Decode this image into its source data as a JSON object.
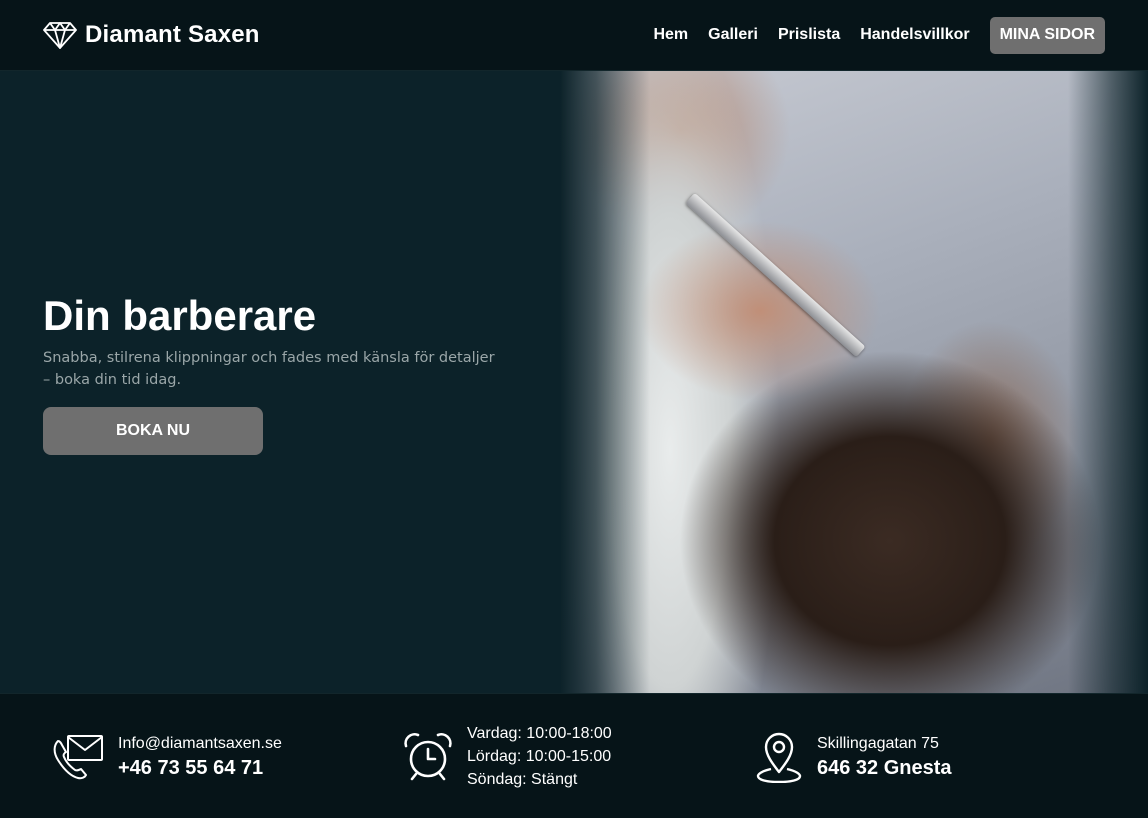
{
  "header": {
    "brand": "Diamant Saxen",
    "logo_icon": "diamond-icon",
    "nav": [
      "Hem",
      "Galleri",
      "Prislista",
      "Handelsvillkor"
    ],
    "account_button": "MINA SIDOR"
  },
  "hero": {
    "title": "Din barberare",
    "subtitle_line1": "Snabba, stilrena klippningar och fades med känsla för detaljer",
    "subtitle_line2": "– boka din tid idag.",
    "cta": "BOKA NU"
  },
  "footer": {
    "contact": {
      "icon": "phone-mail-icon",
      "email": "Info@diamantsaxen.se",
      "phone": "+46 73 55 64 71"
    },
    "hours": {
      "icon": "alarm-clock-icon",
      "weekday": "Vardag: 10:00-18:00",
      "saturday": "Lördag: 10:00-15:00",
      "sunday": "Söndag: Stängt"
    },
    "address": {
      "icon": "location-pin-icon",
      "street": "Skillingagatan 75",
      "city": "646 32 Gnesta"
    }
  },
  "colors": {
    "header_bg": "#061418",
    "hero_bg": "#0c2229",
    "button_bg": "#6f6f6f",
    "subtitle": "#9aa6a8"
  }
}
